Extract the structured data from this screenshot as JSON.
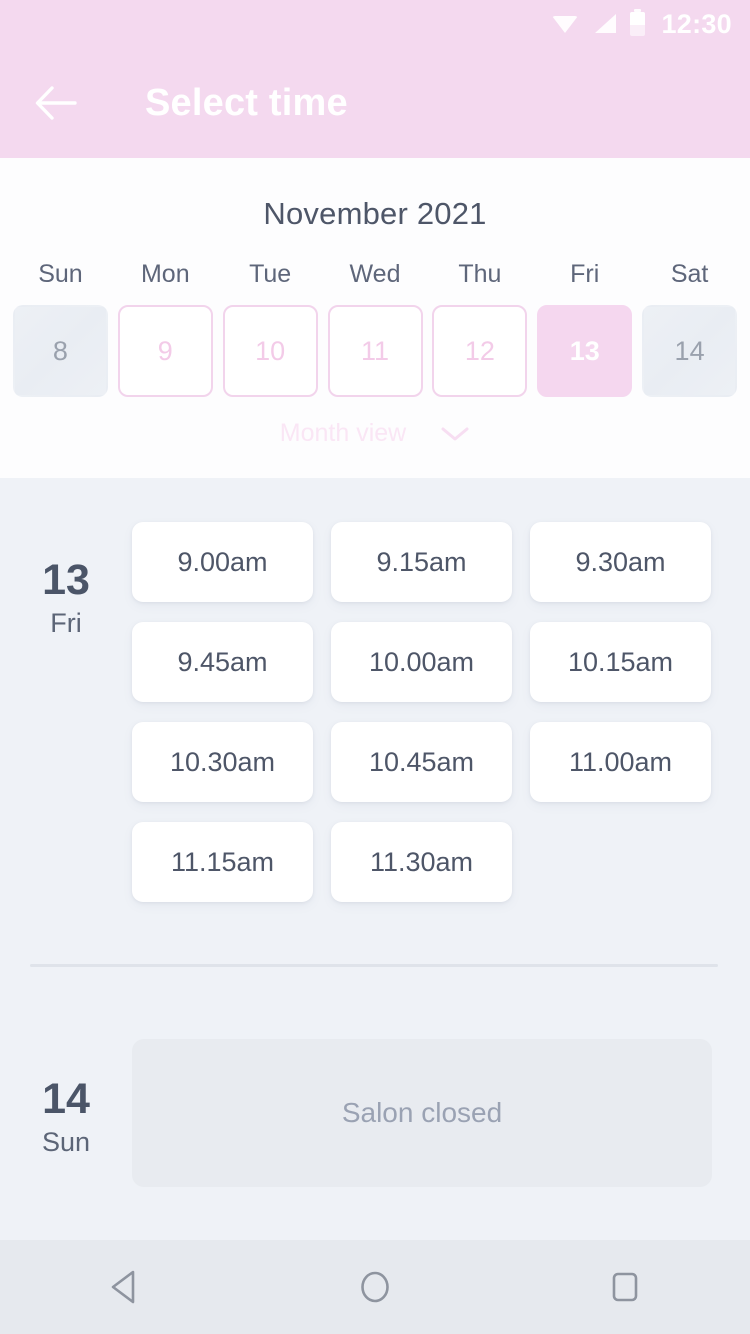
{
  "status_bar": {
    "time": "12:30",
    "icons": [
      "wifi-icon",
      "signal-icon",
      "battery-icon"
    ]
  },
  "app_bar": {
    "back_icon": "arrow-left-icon",
    "title": "Select time",
    "background_color": "#f4d9ef",
    "title_color": "#ffffff"
  },
  "calendar": {
    "month_title": "November 2021",
    "weekdays": [
      "Sun",
      "Mon",
      "Tue",
      "Wed",
      "Thu",
      "Fri",
      "Sat"
    ],
    "days": [
      {
        "number": "8",
        "state": "disabled"
      },
      {
        "number": "9",
        "state": "available"
      },
      {
        "number": "10",
        "state": "available"
      },
      {
        "number": "11",
        "state": "available"
      },
      {
        "number": "12",
        "state": "available"
      },
      {
        "number": "13",
        "state": "selected"
      },
      {
        "number": "14",
        "state": "disabled"
      }
    ],
    "view_toggle": {
      "label": "Month view",
      "icon": "chevron-down-icon"
    },
    "colors": {
      "selected_bg": "#f5d7ef",
      "available_border": "#f2d4ec",
      "available_text": "#f3cbe8",
      "disabled_bg": "#edf0f5",
      "disabled_text": "#9aa1ad",
      "month_title_text": "#4e5668",
      "weekday_text": "#5e667a",
      "view_toggle_text": "#fae6f5"
    }
  },
  "schedule": {
    "days": [
      {
        "number": "13",
        "weekday": "Fri",
        "closed": false,
        "slots": [
          "9.00am",
          "9.15am",
          "9.30am",
          "9.45am",
          "10.00am",
          "10.15am",
          "10.30am",
          "10.45am",
          "11.00am",
          "11.15am",
          "11.30am"
        ]
      },
      {
        "number": "14",
        "weekday": "Sun",
        "closed": true,
        "closed_message": "Salon closed",
        "slots": []
      }
    ],
    "colors": {
      "background": "#eff2f7",
      "slot_bg": "#ffffff",
      "slot_text": "#4e5668",
      "day_number_text": "#4b5568",
      "closed_card_bg": "#e8ebf0",
      "closed_text": "#9aa2b3",
      "divider": "#dfe3ea"
    }
  },
  "nav_bar": {
    "buttons": [
      {
        "name": "back-nav-icon",
        "icon": "triangle-left-icon"
      },
      {
        "name": "home-nav-icon",
        "icon": "circle-icon"
      },
      {
        "name": "recents-nav-icon",
        "icon": "square-icon"
      }
    ],
    "background_color": "#e6e9ee",
    "icon_color": "#8e949f"
  }
}
